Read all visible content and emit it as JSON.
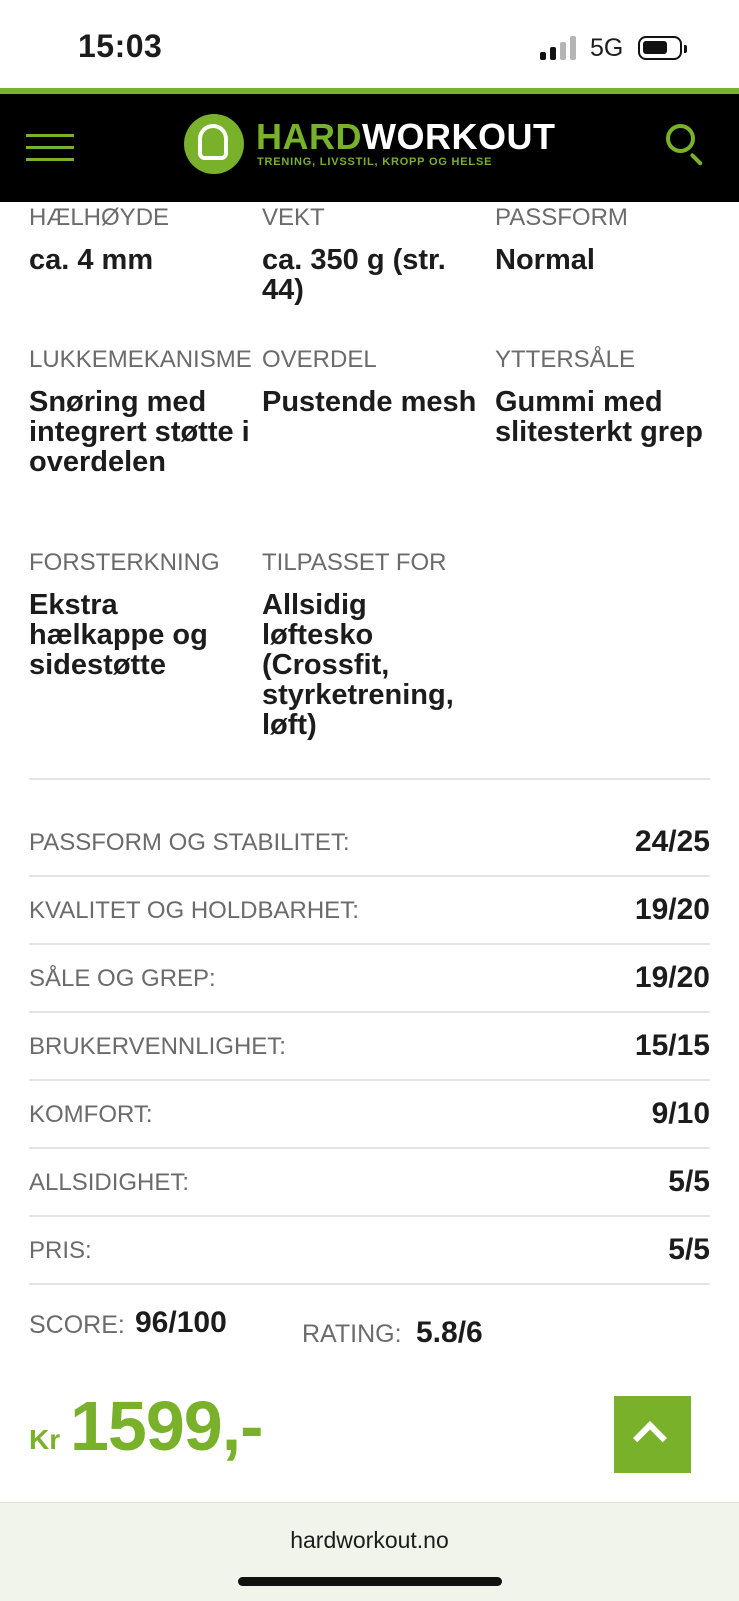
{
  "status_bar": {
    "time": "15:03",
    "network": "5G"
  },
  "header": {
    "brand_green": "HARD",
    "brand_white": "WORKOUT",
    "tagline": "TRENING, LIVSSTIL, KROPP OG HELSE"
  },
  "specs": [
    {
      "label": "HÆLHØYDE",
      "value": "ca. 4 mm"
    },
    {
      "label": "VEKT",
      "value": "ca. 350 g (str. 44)"
    },
    {
      "label": "PASSFORM",
      "value": "Normal"
    },
    {
      "label": "LUKKEMEKANISME",
      "value": "Snøring med integrert støtte i overdelen"
    },
    {
      "label": "OVERDEL",
      "value": "Pustende mesh"
    },
    {
      "label": "YTTERSÅLE",
      "value": "Gummi med slitesterkt grep"
    },
    {
      "label": "FORSTERKNING",
      "value": "Ekstra hælkappe og sidestøtte"
    },
    {
      "label": "TILPASSET FOR",
      "value": "Allsidig løftesko (Crossfit, styrketrening, løft)"
    }
  ],
  "scores": [
    {
      "label": "PASSFORM OG STABILITET:",
      "value": "24/25"
    },
    {
      "label": "KVALITET OG HOLDBARHET:",
      "value": "19/20"
    },
    {
      "label": "SÅLE OG GREP:",
      "value": "19/20"
    },
    {
      "label": "BRUKERVENNLIGHET:",
      "value": "15/15"
    },
    {
      "label": "KOMFORT:",
      "value": "9/10"
    },
    {
      "label": "ALLSIDIGHET:",
      "value": "5/5"
    },
    {
      "label": "PRIS:",
      "value": "5/5"
    }
  ],
  "summary": {
    "score_label": "SCORE:",
    "score_value": "96/100",
    "rating_label": "RATING:",
    "rating_value": "5.8/6"
  },
  "price": {
    "currency": "Kr",
    "amount": "1599,-"
  },
  "browser": {
    "url": "hardworkout.no"
  },
  "colors": {
    "accent": "#79b12a",
    "header_bg": "#000000",
    "label_gray": "#6b6b6b"
  },
  "icons": [
    "hamburger-menu-icon",
    "search-icon",
    "scroll-to-top-icon",
    "signal-icon",
    "battery-icon"
  ]
}
